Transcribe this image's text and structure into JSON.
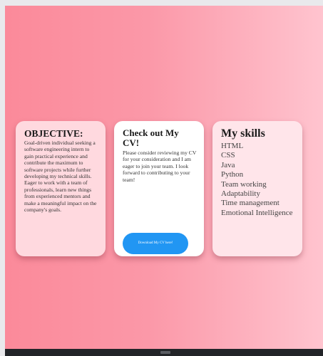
{
  "objective": {
    "title": "OBJECTIVE:",
    "body": "Goal-driven individual seeking a software engineering intern to gain practical experience and contribute the maximum to software projects while further developing my technical skills. Eager to work with a team of professionals, learn new things from experienced mentors and make a meaningful impact on the company's goals."
  },
  "cv": {
    "title": "Check out My CV!",
    "body": "Please consider reviewing my CV for your consideration and I am eager to join your team. I look forward to contributing to your team!",
    "button_label": "Download My CV here!"
  },
  "skills": {
    "title": "My skills",
    "items": [
      "HTML",
      "CSS",
      "Java",
      "Python",
      "Team working",
      "Adaptability",
      "Time management",
      "Emotional Intelligence"
    ]
  },
  "colors": {
    "gradient_start": "#fb8a9a",
    "gradient_end": "#ffc4cf",
    "button": "#2196f3",
    "objective_card": "#ffd9df",
    "cv_card": "#ffffff",
    "skills_card": "#ffe5ea"
  }
}
